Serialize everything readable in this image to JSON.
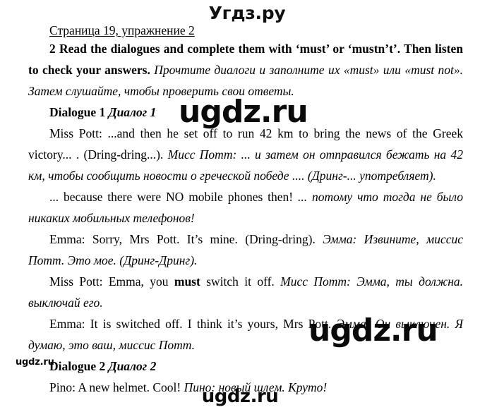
{
  "page": {
    "brand_header": "Угдз.ру",
    "title": "Страница 19, упражнение 2"
  },
  "exercise": {
    "number_and_task_en": "2 Read the dialogues and complete them with ‘must’ or ‘mustn’t’. Then listen to check your answers.",
    "task_ru": "Прочтите диалоги и заполните их «must» или «must not». Затем слушайте, чтобы проверить свои ответы."
  },
  "dialogues": [
    {
      "heading_en": "Dialogue 1",
      "heading_ru": "Диалог 1",
      "lines": [
        {
          "en": "Miss Pott: ...and then he set off to run 42 km to bring the news of the Greek victory... . (Dring-dring...).",
          "ru": "Мисс Потт: ... и затем он отправился бежать на 42 км, чтобы сообщить новости о греческой победе .... (Дринг-... употребляет)."
        },
        {
          "en": "... because there were NO mobile phones then!",
          "ru": "... потому что тогда не было никаких мобильных телефонов!"
        },
        {
          "en": "Emma: Sorry, Mrs Pott. It’s mine. (Dring-dring).",
          "ru": "Эмма: Извините, миссис Потт. Это мое. (Дринг-Дринг)."
        },
        {
          "en_pre": "Miss Pott: Emma, you ",
          "en_bold": "must",
          "en_post": " switch it off.",
          "ru": "Мисс Потт: Эмма, ты должна. выключай его."
        },
        {
          "en": "Emma: It is switched off. I think it’s yours, Mrs Pott.",
          "ru": "Эмма: Он выключен. Я думаю, это ваш, миссис Потт."
        }
      ]
    },
    {
      "heading_en": "Dialogue 2",
      "heading_ru": "Диалог 2",
      "lines": [
        {
          "en": "Pino: A new helmet. Cool!",
          "ru": "Пино: новый шлем. Круто!"
        }
      ]
    }
  ],
  "watermarks": {
    "big_1": "ugdz.ru",
    "big_2": "ugdz.ru",
    "small_left": "ugdz.ru",
    "bottom": "ugdz.ru"
  }
}
